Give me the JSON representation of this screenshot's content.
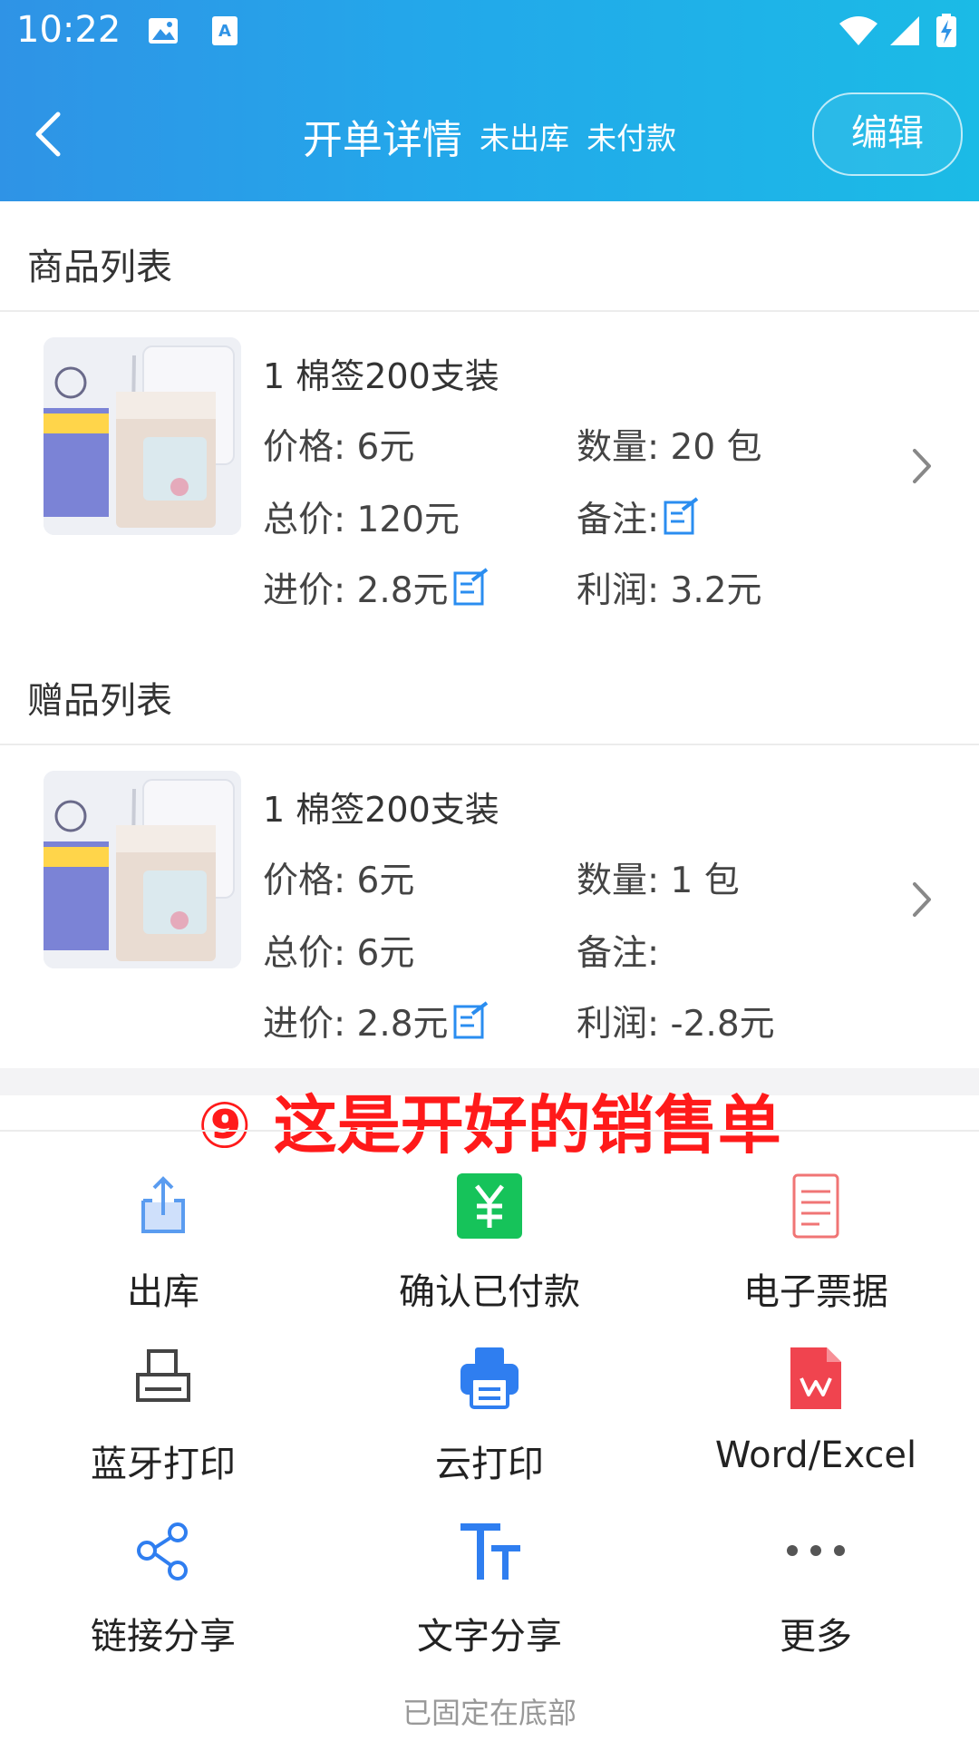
{
  "status_bar": {
    "time": "10:22"
  },
  "header": {
    "title": "开单详情",
    "status_out": "未出库",
    "status_pay": "未付款",
    "edit_label": "编辑"
  },
  "products_section": {
    "title": "商品列表",
    "item": {
      "name": "1 棉签200支装",
      "price": "价格: 6元",
      "qty": "数量: 20 包",
      "total": "总价: 120元",
      "note": "备注:",
      "cost": "进价: 2.8元",
      "profit": "利润: 3.2元"
    }
  },
  "gifts_section": {
    "title": "赠品列表",
    "item": {
      "name": "1 棉签200支装",
      "price": "价格: 6元",
      "qty": "数量: 1 包",
      "total": "总价: 6元",
      "note": "备注:",
      "cost": "进价: 2.8元",
      "profit": "利润: -2.8元"
    }
  },
  "annotation": "⑨ 这是开好的销售单",
  "actions": [
    {
      "label": "出库",
      "icon": "upload-share-icon"
    },
    {
      "label": "确认已付款",
      "icon": "yuan-payment-icon"
    },
    {
      "label": "电子票据",
      "icon": "document-icon"
    },
    {
      "label": "蓝牙打印",
      "icon": "printer-icon"
    },
    {
      "label": "云打印",
      "icon": "cloud-printer-icon"
    },
    {
      "label": "Word/Excel",
      "icon": "wps-file-icon"
    },
    {
      "label": "链接分享",
      "icon": "share-nodes-icon"
    },
    {
      "label": "文字分享",
      "icon": "text-size-icon"
    },
    {
      "label": "更多",
      "icon": "more-dots-icon"
    }
  ],
  "footer_note": "已固定在底部",
  "colors": {
    "accent_blue": "#2f93e6",
    "annotation_red": "#ff1a1a",
    "pay_green": "#16c35a"
  }
}
